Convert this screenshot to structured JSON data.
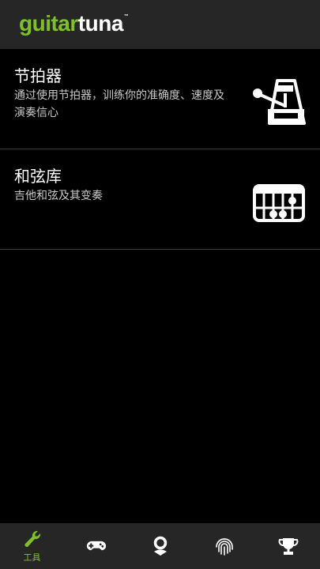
{
  "app": {
    "logo_green": "guitar",
    "logo_white": "tuna",
    "logo_tm": "™",
    "brand_color": "#7ec02b"
  },
  "tools": [
    {
      "title": "节拍器",
      "description": "通过使用节拍器，训练你的准确度、速度及演奏信心",
      "icon": "metronome-icon"
    },
    {
      "title": "和弦库",
      "description": "吉他和弦及其变奏",
      "icon": "chord-chart-icon"
    }
  ],
  "tabbar": {
    "tabs": [
      {
        "icon": "wrench-icon",
        "label": "工具",
        "active": true
      },
      {
        "icon": "gamepad-icon",
        "active": false
      },
      {
        "icon": "tuner-icon",
        "active": false
      },
      {
        "icon": "fingerprint-icon",
        "active": false
      },
      {
        "icon": "trophy-icon",
        "active": false
      }
    ]
  }
}
